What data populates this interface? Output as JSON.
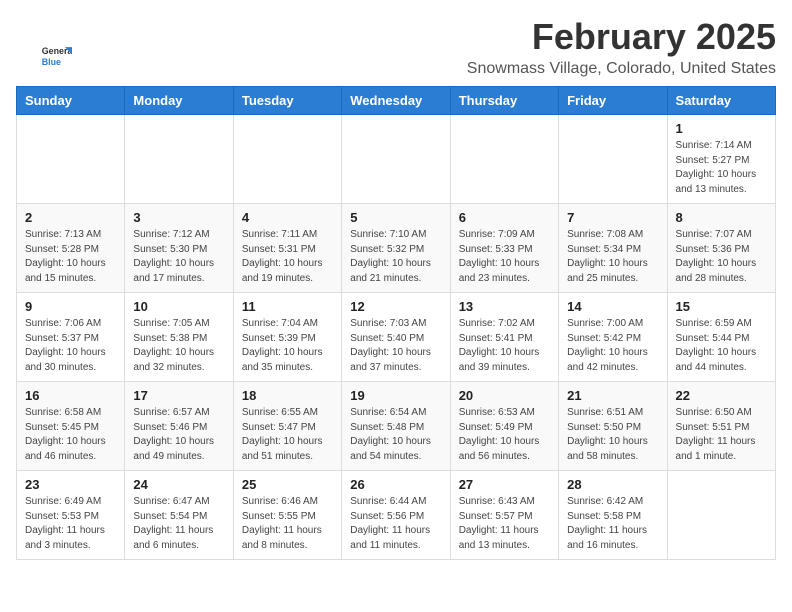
{
  "header": {
    "logo_line1": "General",
    "logo_line2": "Blue",
    "month": "February 2025",
    "location": "Snowmass Village, Colorado, United States"
  },
  "days_of_week": [
    "Sunday",
    "Monday",
    "Tuesday",
    "Wednesday",
    "Thursday",
    "Friday",
    "Saturday"
  ],
  "weeks": [
    [
      {
        "day": "",
        "info": ""
      },
      {
        "day": "",
        "info": ""
      },
      {
        "day": "",
        "info": ""
      },
      {
        "day": "",
        "info": ""
      },
      {
        "day": "",
        "info": ""
      },
      {
        "day": "",
        "info": ""
      },
      {
        "day": "1",
        "info": "Sunrise: 7:14 AM\nSunset: 5:27 PM\nDaylight: 10 hours and 13 minutes."
      }
    ],
    [
      {
        "day": "2",
        "info": "Sunrise: 7:13 AM\nSunset: 5:28 PM\nDaylight: 10 hours and 15 minutes."
      },
      {
        "day": "3",
        "info": "Sunrise: 7:12 AM\nSunset: 5:30 PM\nDaylight: 10 hours and 17 minutes."
      },
      {
        "day": "4",
        "info": "Sunrise: 7:11 AM\nSunset: 5:31 PM\nDaylight: 10 hours and 19 minutes."
      },
      {
        "day": "5",
        "info": "Sunrise: 7:10 AM\nSunset: 5:32 PM\nDaylight: 10 hours and 21 minutes."
      },
      {
        "day": "6",
        "info": "Sunrise: 7:09 AM\nSunset: 5:33 PM\nDaylight: 10 hours and 23 minutes."
      },
      {
        "day": "7",
        "info": "Sunrise: 7:08 AM\nSunset: 5:34 PM\nDaylight: 10 hours and 25 minutes."
      },
      {
        "day": "8",
        "info": "Sunrise: 7:07 AM\nSunset: 5:36 PM\nDaylight: 10 hours and 28 minutes."
      }
    ],
    [
      {
        "day": "9",
        "info": "Sunrise: 7:06 AM\nSunset: 5:37 PM\nDaylight: 10 hours and 30 minutes."
      },
      {
        "day": "10",
        "info": "Sunrise: 7:05 AM\nSunset: 5:38 PM\nDaylight: 10 hours and 32 minutes."
      },
      {
        "day": "11",
        "info": "Sunrise: 7:04 AM\nSunset: 5:39 PM\nDaylight: 10 hours and 35 minutes."
      },
      {
        "day": "12",
        "info": "Sunrise: 7:03 AM\nSunset: 5:40 PM\nDaylight: 10 hours and 37 minutes."
      },
      {
        "day": "13",
        "info": "Sunrise: 7:02 AM\nSunset: 5:41 PM\nDaylight: 10 hours and 39 minutes."
      },
      {
        "day": "14",
        "info": "Sunrise: 7:00 AM\nSunset: 5:42 PM\nDaylight: 10 hours and 42 minutes."
      },
      {
        "day": "15",
        "info": "Sunrise: 6:59 AM\nSunset: 5:44 PM\nDaylight: 10 hours and 44 minutes."
      }
    ],
    [
      {
        "day": "16",
        "info": "Sunrise: 6:58 AM\nSunset: 5:45 PM\nDaylight: 10 hours and 46 minutes."
      },
      {
        "day": "17",
        "info": "Sunrise: 6:57 AM\nSunset: 5:46 PM\nDaylight: 10 hours and 49 minutes."
      },
      {
        "day": "18",
        "info": "Sunrise: 6:55 AM\nSunset: 5:47 PM\nDaylight: 10 hours and 51 minutes."
      },
      {
        "day": "19",
        "info": "Sunrise: 6:54 AM\nSunset: 5:48 PM\nDaylight: 10 hours and 54 minutes."
      },
      {
        "day": "20",
        "info": "Sunrise: 6:53 AM\nSunset: 5:49 PM\nDaylight: 10 hours and 56 minutes."
      },
      {
        "day": "21",
        "info": "Sunrise: 6:51 AM\nSunset: 5:50 PM\nDaylight: 10 hours and 58 minutes."
      },
      {
        "day": "22",
        "info": "Sunrise: 6:50 AM\nSunset: 5:51 PM\nDaylight: 11 hours and 1 minute."
      }
    ],
    [
      {
        "day": "23",
        "info": "Sunrise: 6:49 AM\nSunset: 5:53 PM\nDaylight: 11 hours and 3 minutes."
      },
      {
        "day": "24",
        "info": "Sunrise: 6:47 AM\nSunset: 5:54 PM\nDaylight: 11 hours and 6 minutes."
      },
      {
        "day": "25",
        "info": "Sunrise: 6:46 AM\nSunset: 5:55 PM\nDaylight: 11 hours and 8 minutes."
      },
      {
        "day": "26",
        "info": "Sunrise: 6:44 AM\nSunset: 5:56 PM\nDaylight: 11 hours and 11 minutes."
      },
      {
        "day": "27",
        "info": "Sunrise: 6:43 AM\nSunset: 5:57 PM\nDaylight: 11 hours and 13 minutes."
      },
      {
        "day": "28",
        "info": "Sunrise: 6:42 AM\nSunset: 5:58 PM\nDaylight: 11 hours and 16 minutes."
      },
      {
        "day": "",
        "info": ""
      }
    ]
  ]
}
